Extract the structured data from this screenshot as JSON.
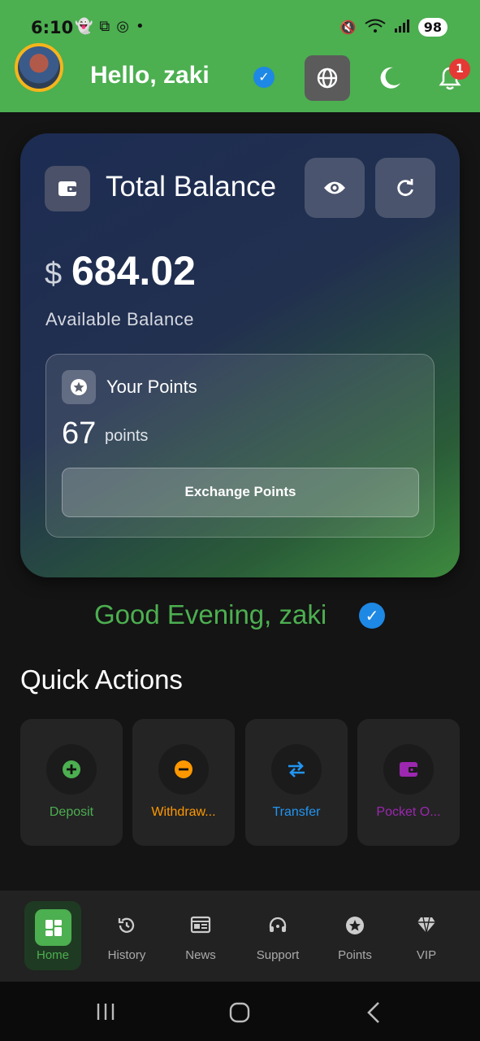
{
  "status_bar": {
    "time": "6:10",
    "battery": "98"
  },
  "header": {
    "greeting": "Hello, zaki",
    "notification_count": "1"
  },
  "balance_card": {
    "title": "Total Balance",
    "currency_symbol": "$",
    "amount": "684.02",
    "available_label": "Available Balance",
    "points": {
      "title": "Your Points",
      "value": "67",
      "unit": "points",
      "exchange_label": "Exchange Points"
    }
  },
  "good_evening": "Good Evening, zaki",
  "quick_actions": {
    "title": "Quick Actions",
    "items": [
      {
        "label": "Deposit",
        "color": "#4caf50",
        "icon": "plus-icon"
      },
      {
        "label": "Withdraw...",
        "color": "#ff9800",
        "icon": "minus-icon"
      },
      {
        "label": "Transfer",
        "color": "#2196f3",
        "icon": "swap-icon"
      },
      {
        "label": "Pocket O...",
        "color": "#9c27b0",
        "icon": "wallet-icon"
      }
    ]
  },
  "bottom_nav": {
    "items": [
      {
        "label": "Home",
        "icon": "grid-icon",
        "active": true
      },
      {
        "label": "History",
        "icon": "history-icon"
      },
      {
        "label": "News",
        "icon": "news-icon"
      },
      {
        "label": "Support",
        "icon": "headset-icon"
      },
      {
        "label": "Points",
        "icon": "star-icon"
      },
      {
        "label": "VIP",
        "icon": "diamond-icon"
      }
    ]
  },
  "colors": {
    "brand_green": "#4caf50",
    "background": "#141414"
  }
}
